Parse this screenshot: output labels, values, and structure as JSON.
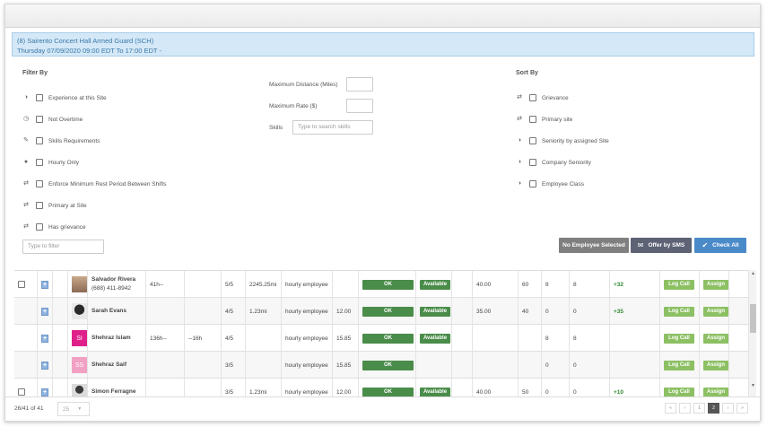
{
  "shift": {
    "site": "(8) Sairento Concert Hall Armed Guard (SCH)",
    "time": "Thursday 07/09/2020 09:00 EDT To 17:00 EDT -"
  },
  "filters": {
    "title": "Filter By",
    "options": [
      {
        "label": "Experience at this Site",
        "icon": "clock-badge-icon",
        "glyph": "◑"
      },
      {
        "label": "Not Overtime",
        "icon": "clock-icon",
        "glyph": "◷"
      },
      {
        "label": "Skills Requirements",
        "icon": "wrench-icon",
        "glyph": "✎"
      },
      {
        "label": "Hourly Only",
        "icon": "user-icon",
        "glyph": "●"
      },
      {
        "label": "Enforce Minimum Rest Period Between Shifts",
        "icon": "exchange-icon",
        "glyph": "⇄"
      },
      {
        "label": "Primary at Site",
        "icon": "exchange-icon",
        "glyph": "⇄"
      },
      {
        "label": "Has grievance",
        "icon": "exchange-icon",
        "glyph": "⇄"
      }
    ],
    "max_distance_label": "Maximum Distance (Miles)",
    "max_rate_label": "Maximum Rate ($)",
    "skills_label": "Skills",
    "skills_placeholder": "Type to search skills",
    "filter_placeholder": "Type to filter"
  },
  "sort": {
    "title": "Sort By",
    "options": [
      {
        "label": "Grievance",
        "icon": "exchange-icon",
        "glyph": "⇄"
      },
      {
        "label": "Primary site",
        "icon": "exchange-icon",
        "glyph": "⇄"
      },
      {
        "label": "Seniority by assigned Site",
        "icon": "clock-badge-icon",
        "glyph": "◑"
      },
      {
        "label": "Company Seniority",
        "icon": "clock-badge-icon",
        "glyph": "◑"
      },
      {
        "label": "Employee Class",
        "icon": "clock-badge-icon",
        "glyph": "◑"
      }
    ]
  },
  "actions": {
    "no_employee": "No Employee Selected",
    "offer_sms": "Offer by SMS",
    "check_all": "Check All",
    "sms_icon": "envelope-icon",
    "check_icon": "check-circle-icon"
  },
  "rows": [
    {
      "checkbox": true,
      "avatar": "photo-a",
      "initials": "",
      "name": "Salvador Rivera",
      "phone": "(688) 411-8942",
      "c1": "41h--",
      "c2": "",
      "c3": "5/5",
      "c4": "2245.25mi",
      "c5": "hourly employee",
      "c6": "",
      "status": "OK",
      "avail": "Available",
      "c7": "",
      "c8": "40.00",
      "c9": "60",
      "c10": "8",
      "c11": "8",
      "delta": "+32",
      "log": "Log Call",
      "assign": "Assign"
    },
    {
      "checkbox": false,
      "avatar": "photo-b",
      "initials": "",
      "name": "Sarah Evans",
      "phone": "",
      "c1": "",
      "c2": "",
      "c3": "4/5",
      "c4": "1.23mi",
      "c5": "hourly employee",
      "c6": "12.00",
      "status": "OK",
      "avail": "Available",
      "c7": "",
      "c8": "35.00",
      "c9": "40",
      "c10": "0",
      "c11": "0",
      "delta": "+35",
      "log": "Log Call",
      "assign": "Assign"
    },
    {
      "checkbox": false,
      "avatar": "si",
      "initials": "SI",
      "name": "Shehraz Islam",
      "phone": "",
      "c1": "136h--",
      "c2": "--16h",
      "c3": "4/5",
      "c4": "",
      "c5": "hourly employee",
      "c6": "15.85",
      "status": "OK",
      "avail": "Available",
      "c7": "",
      "c8": "",
      "c9": "",
      "c10": "8",
      "c11": "8",
      "delta": "",
      "log": "Log Call",
      "assign": "Assign"
    },
    {
      "checkbox": false,
      "avatar": "ss",
      "initials": "SS",
      "name": "Shehraz Saif",
      "phone": "",
      "c1": "",
      "c2": "",
      "c3": "3/5",
      "c4": "",
      "c5": "hourly employee",
      "c6": "15.85",
      "status": "OK",
      "avail": "",
      "c7": "",
      "c8": "",
      "c9": "",
      "c10": "0",
      "c11": "0",
      "delta": "",
      "log": "Log Call",
      "assign": "Assign"
    },
    {
      "checkbox": true,
      "avatar": "photo-c",
      "initials": "",
      "name": "Simon Ferragne",
      "phone": "",
      "c1": "",
      "c2": "",
      "c3": "3/5",
      "c4": "1.23mi",
      "c5": "hourly employee",
      "c6": "12.00",
      "status": "OK",
      "avail": "Available",
      "c7": "",
      "c8": "40.00",
      "c9": "50",
      "c10": "0",
      "c11": "0",
      "delta": "+10",
      "log": "Log Call",
      "assign": "Assign"
    }
  ],
  "footer": {
    "count": "26/41 of 41",
    "page_size": "25",
    "pages": [
      "«",
      "‹",
      "1",
      "2",
      "›",
      "»"
    ],
    "active_page": "2"
  }
}
